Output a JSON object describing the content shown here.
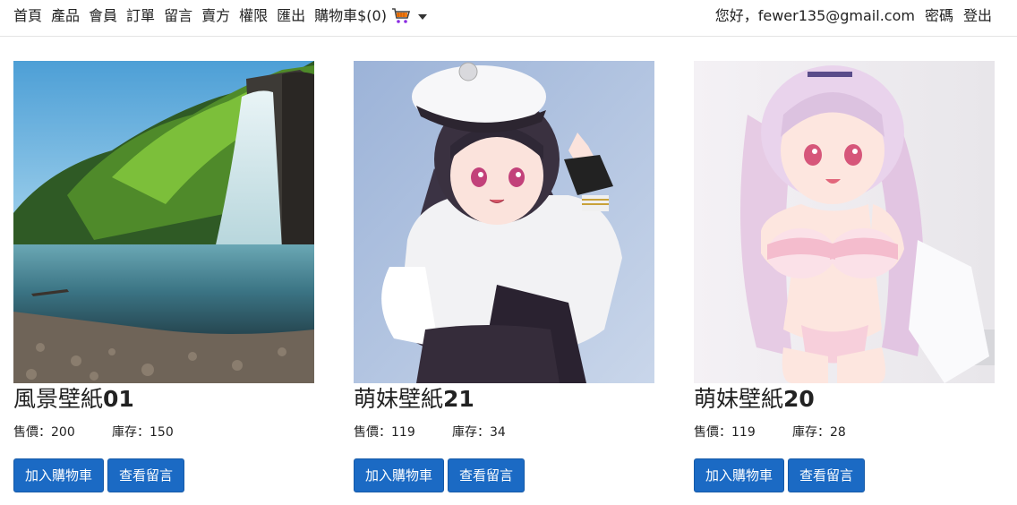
{
  "nav": {
    "items": [
      "首頁",
      "產品",
      "會員",
      "訂單",
      "留言",
      "賣方",
      "權限",
      "匯出"
    ],
    "cart_label": "購物車$(0)",
    "greeting": "您好，fewer135@gmail.com",
    "password": "密碼",
    "logout": "登出"
  },
  "products": [
    {
      "name": "風景壁紙",
      "number": "01",
      "price_label": "售價：200",
      "stock_label": "庫存：150",
      "add_cart": "加入購物車",
      "view_comments": "查看留言"
    },
    {
      "name": "萌妹壁紙",
      "number": "21",
      "price_label": "售價：119",
      "stock_label": "庫存：34",
      "add_cart": "加入購物車",
      "view_comments": "查看留言"
    },
    {
      "name": "萌妹壁紙",
      "number": "20",
      "price_label": "售價：119",
      "stock_label": "庫存：28",
      "add_cart": "加入購物車",
      "view_comments": "查看留言"
    }
  ],
  "colors": {
    "button": "#1b6ac4",
    "text": "#222222",
    "border": "#e4e4e4"
  },
  "icons": {
    "cart": "shopping-cart-icon",
    "dropdown": "caret-down-icon"
  }
}
